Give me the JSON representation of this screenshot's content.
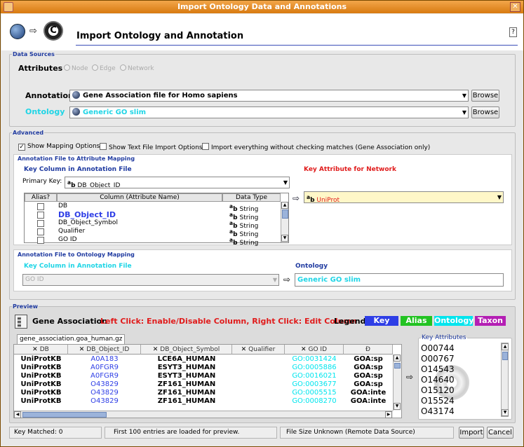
{
  "window": {
    "title": "Import Ontology Data and Annotations",
    "close_glyph": "✕"
  },
  "header": {
    "title": "Import Ontology and Annotation",
    "help_label": "?",
    "arrow": "⇨",
    "icon_letter": "C"
  },
  "data_sources": {
    "legend": "Data Sources",
    "attributes_label": "Attributes",
    "radios": [
      "Node",
      "Edge",
      "Network"
    ],
    "annotation_label": "Annotation",
    "annotation_value": "Gene Association file for Homo sapiens",
    "ontology_label": "Ontology",
    "ontology_value": "Generic GO slim",
    "browse_label": "Browse"
  },
  "advanced": {
    "legend": "Advanced",
    "options": [
      "Show Mapping Options",
      "Show Text File Import Options",
      "Import everything without checking matches (Gene Association only)"
    ]
  },
  "attr_mapping": {
    "title": "Annotation File to Attribute Mapping",
    "key_col_title": "Key Column in Annotation File",
    "primary_key_label": "Primary Key:",
    "primary_key_value": "DB_Object_ID",
    "key_attr_title": "Key Attribute for Network",
    "key_attr_value": "UniProt",
    "columns": [
      "Alias?",
      "Column (Attribute Name)",
      "Data Type"
    ],
    "type_prefix": "a",
    "type_prefix_sub": "b",
    "rows": [
      {
        "name": "DB",
        "type": "String"
      },
      {
        "name": "DB_Object_ID",
        "type": "String"
      },
      {
        "name": "DB_Object_Symbol",
        "type": "String"
      },
      {
        "name": "Qualifier",
        "type": "String"
      },
      {
        "name": "GO ID",
        "type": "String"
      }
    ]
  },
  "onto_mapping": {
    "title": "Annotation File to Ontology Mapping",
    "key_col_title": "Key Column in Annotation File",
    "key_col_value": "GO ID",
    "ontology_title": "Ontology",
    "ontology_value": "Generic GO slim"
  },
  "preview": {
    "legend": "Preview",
    "file_label": "Gene Association",
    "hint": "Left Click: Enable/Disable Column, Right Click: Edit Column",
    "legend_label": "Legend:",
    "legend_items": [
      {
        "label": "Key",
        "bg": "#2e3ee6",
        "fg": "#ffffff"
      },
      {
        "label": "Alias",
        "bg": "#22c322",
        "fg": "#ffffff"
      },
      {
        "label": "Ontology",
        "bg": "#00e5ee",
        "fg": "#ffffff"
      },
      {
        "label": "Taxon",
        "bg": "#b41fb4",
        "fg": "#ffffff"
      }
    ],
    "tab_label": "gene_association.goa_human.gz",
    "columns": [
      "DB",
      "DB_Object_ID",
      "DB_Object_Symbol",
      "Qualifier",
      "GO ID",
      "Đ"
    ],
    "rows": [
      [
        "UniProtKB",
        "A0A183",
        "LCE6A_HUMAN",
        "",
        "GO:0031424",
        "GOA:sp"
      ],
      [
        "UniProtKB",
        "A0FGR9",
        "ESYT3_HUMAN",
        "",
        "GO:0005886",
        "GOA:sp"
      ],
      [
        "UniProtKB",
        "A0FGR9",
        "ESYT3_HUMAN",
        "",
        "GO:0016021",
        "GOA:sp"
      ],
      [
        "UniProtKB",
        "O43829",
        "ZF161_HUMAN",
        "",
        "GO:0003677",
        "GOA:sp"
      ],
      [
        "UniProtKB",
        "O43829",
        "ZF161_HUMAN",
        "",
        "GO:0005515",
        "GOA:inte"
      ],
      [
        "UniProtKB",
        "O43829",
        "ZF161_HUMAN",
        "",
        "GO:0008270",
        "GOA:inte"
      ]
    ],
    "key_attr_legend": "Key Attributes",
    "key_attrs": [
      "O00744",
      "O00767",
      "O14543",
      "O14640",
      "O15120",
      "O15524",
      "O43174"
    ]
  },
  "status": {
    "matched": "Key Matched: 0",
    "entries": "First 100 entries are loaded for preview.",
    "filesize": "File Size Unknown (Remote Data Source)",
    "import_label": "Import",
    "cancel_label": "Cancel"
  },
  "colors": {
    "key": "#2e3ee6",
    "ontology": "#00e5ee",
    "red_title": "#e01b1b"
  }
}
